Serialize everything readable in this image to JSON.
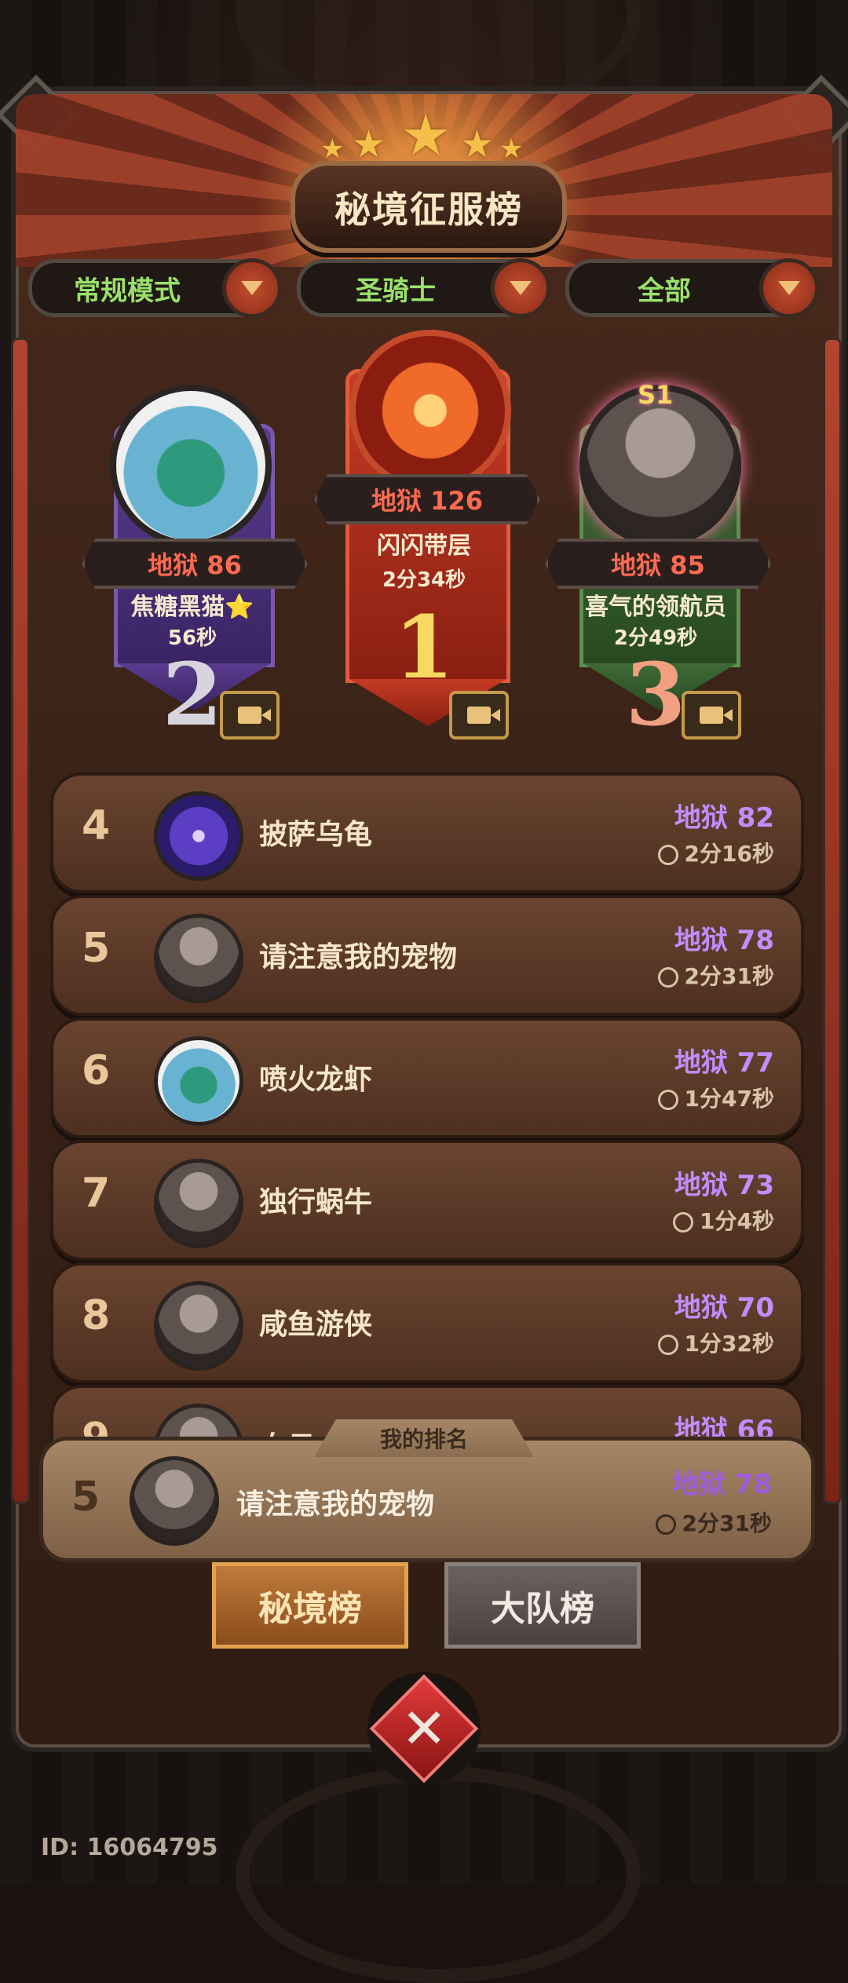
{
  "title": "秘境征服榜",
  "filters": {
    "mode": "常规模式",
    "class": "圣骑士",
    "scope": "全部"
  },
  "podium": [
    {
      "rank": "2",
      "level": "地狱 86",
      "name": "焦糖黑猫⭐",
      "time": "56秒"
    },
    {
      "rank": "1",
      "level": "地狱 126",
      "name": "闪闪带层",
      "time": "2分34秒"
    },
    {
      "rank": "3",
      "level": "地狱 85",
      "name": "喜气的领航员",
      "time": "2分49秒",
      "badge": "S1"
    }
  ],
  "list": [
    {
      "rank": "4",
      "name": "披萨乌龟",
      "level": "地狱 82",
      "time": "2分16秒"
    },
    {
      "rank": "5",
      "name": "请注意我的宠物",
      "level": "地狱 78",
      "time": "2分31秒"
    },
    {
      "rank": "6",
      "name": "喷火龙虾",
      "level": "地狱 77",
      "time": "1分47秒"
    },
    {
      "rank": "7",
      "name": "独行蜗牛",
      "level": "地狱 73",
      "time": "1分4秒"
    },
    {
      "rank": "8",
      "name": "咸鱼游侠",
      "level": "地狱 70",
      "time": "1分32秒"
    },
    {
      "rank": "9",
      "name": "白日",
      "level": "地狱 66",
      "time": ""
    }
  ],
  "my_rank": {
    "tab_label": "我的排名",
    "rank": "5",
    "name": "请注意我的宠物",
    "level": "地狱 78",
    "time": "2分31秒"
  },
  "tabs": {
    "active": "秘境榜",
    "inactive": "大队榜"
  },
  "footer": {
    "id_text": "ID: 16064795"
  },
  "colors": {
    "level_purple": "#c38cff",
    "level_red": "#ff6a52",
    "filter_green": "#9ae06a"
  }
}
